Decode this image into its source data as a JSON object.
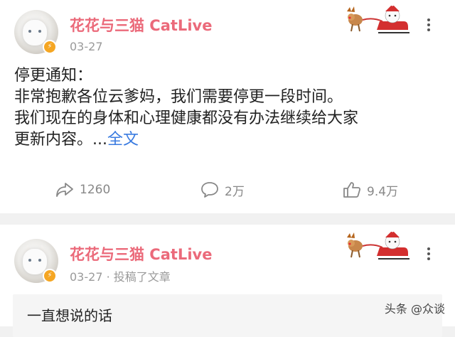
{
  "posts": [
    {
      "author": "花花与三猫 CatLive",
      "date": "03-27",
      "badge_icon": "verified-badge-icon",
      "body_lines": [
        "停更通知：",
        "非常抱歉各位云爹妈，我们需要停更一段时间。",
        "我们现在的身体和心理健康都没有办法继续给大家",
        "更新内容。..."
      ],
      "fulltext_link": "全文",
      "actions": {
        "share_count": "1260",
        "comment_count": "2万",
        "like_count": "9.4万"
      }
    },
    {
      "author": "花花与三猫 CatLive",
      "date_line": "03-27 · 投稿了文章",
      "article_title": "一直想说的话"
    }
  ],
  "watermark": "头条 @众谈",
  "colors": {
    "author_name": "#eb6a7a",
    "link": "#3a7be0",
    "meta": "#9a9a9a",
    "badge": "#f5a623"
  }
}
